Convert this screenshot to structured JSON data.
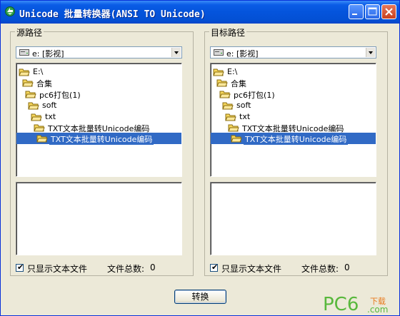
{
  "window": {
    "title": "Unicode 批量转换器(ANSI TO Unicode)"
  },
  "source": {
    "group_label": "源路径",
    "drive": "e: [影视]",
    "tree": [
      {
        "label": "E:\\",
        "open": true,
        "selected": false
      },
      {
        "label": "合集",
        "open": true,
        "selected": false
      },
      {
        "label": "pc6打包(1)",
        "open": true,
        "selected": false
      },
      {
        "label": "soft",
        "open": true,
        "selected": false
      },
      {
        "label": "txt",
        "open": true,
        "selected": false
      },
      {
        "label": "TXT文本批量转Unicode编码",
        "open": true,
        "selected": false
      },
      {
        "label": "TXT文本批量转Unicode编码",
        "open": true,
        "selected": true
      }
    ],
    "only_text_label": "只显示文本文件",
    "only_text_checked": true,
    "count_label": "文件总数:",
    "count_value": "0"
  },
  "target": {
    "group_label": "目标路径",
    "drive": "e: [影视]",
    "tree": [
      {
        "label": "E:\\",
        "open": true,
        "selected": false
      },
      {
        "label": "合集",
        "open": true,
        "selected": false
      },
      {
        "label": "pc6打包(1)",
        "open": true,
        "selected": false
      },
      {
        "label": "soft",
        "open": true,
        "selected": false
      },
      {
        "label": "txt",
        "open": true,
        "selected": false
      },
      {
        "label": "TXT文本批量转Unicode编码",
        "open": true,
        "selected": false
      },
      {
        "label": "TXT文本批量转Unicode编码",
        "open": true,
        "selected": true
      }
    ],
    "only_text_label": "只显示文本文件",
    "only_text_checked": true,
    "count_label": "文件总数:",
    "count_value": "0"
  },
  "convert_label": "转换",
  "checkmark": "✔",
  "watermark": {
    "brand": "PC6",
    "cn": "下载",
    "com": ".com"
  },
  "icons": [
    "app-icon",
    "minimize-icon",
    "maximize-icon",
    "close-icon",
    "drive-icon",
    "folder-open-icon",
    "chevron-down-icon"
  ],
  "colors": {
    "titlebar": "#0454dc",
    "selection": "#316ac5",
    "folder": "#f5d65c",
    "watermark_green": "#58b83c",
    "watermark_orange": "#e8781a"
  }
}
